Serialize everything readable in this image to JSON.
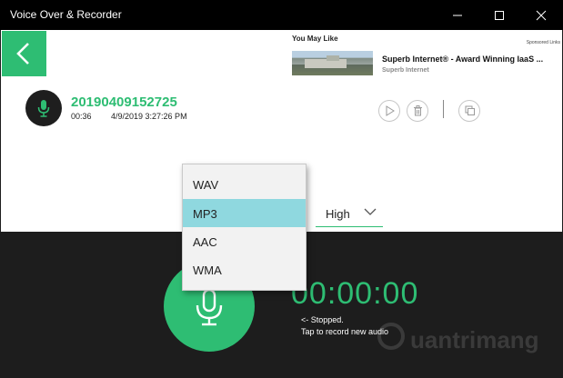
{
  "window": {
    "title": "Voice Over & Recorder",
    "controls": [
      "minimize-icon",
      "maximize-icon",
      "close-icon"
    ]
  },
  "nav": {
    "back_icon": "chevron-left-icon"
  },
  "ad": {
    "heading": "You May Like",
    "sponsored": "Sponsored Links",
    "title": "Superb Internet® - Award Winning IaaS ...",
    "source": "Superb Internet"
  },
  "recording": {
    "name": "20190409152725",
    "duration": "00:36",
    "date": "4/9/2019 3:27:26 PM",
    "actions": [
      "play-icon",
      "trash-icon",
      "copy-icon"
    ]
  },
  "format_menu": {
    "options": [
      "WAV",
      "MP3",
      "AAC",
      "WMA"
    ],
    "selected": "MP3"
  },
  "quality": {
    "value": "High"
  },
  "recorder": {
    "timer": "00:00:00",
    "status": "<- Stopped.",
    "hint": "Tap to record new audio"
  },
  "watermark": {
    "text": "uantrimang"
  },
  "colors": {
    "accent": "#2ebd73",
    "selected_option": "#8fd8df",
    "dark_background": "#1d1d1d",
    "titlebar": "#000000"
  }
}
